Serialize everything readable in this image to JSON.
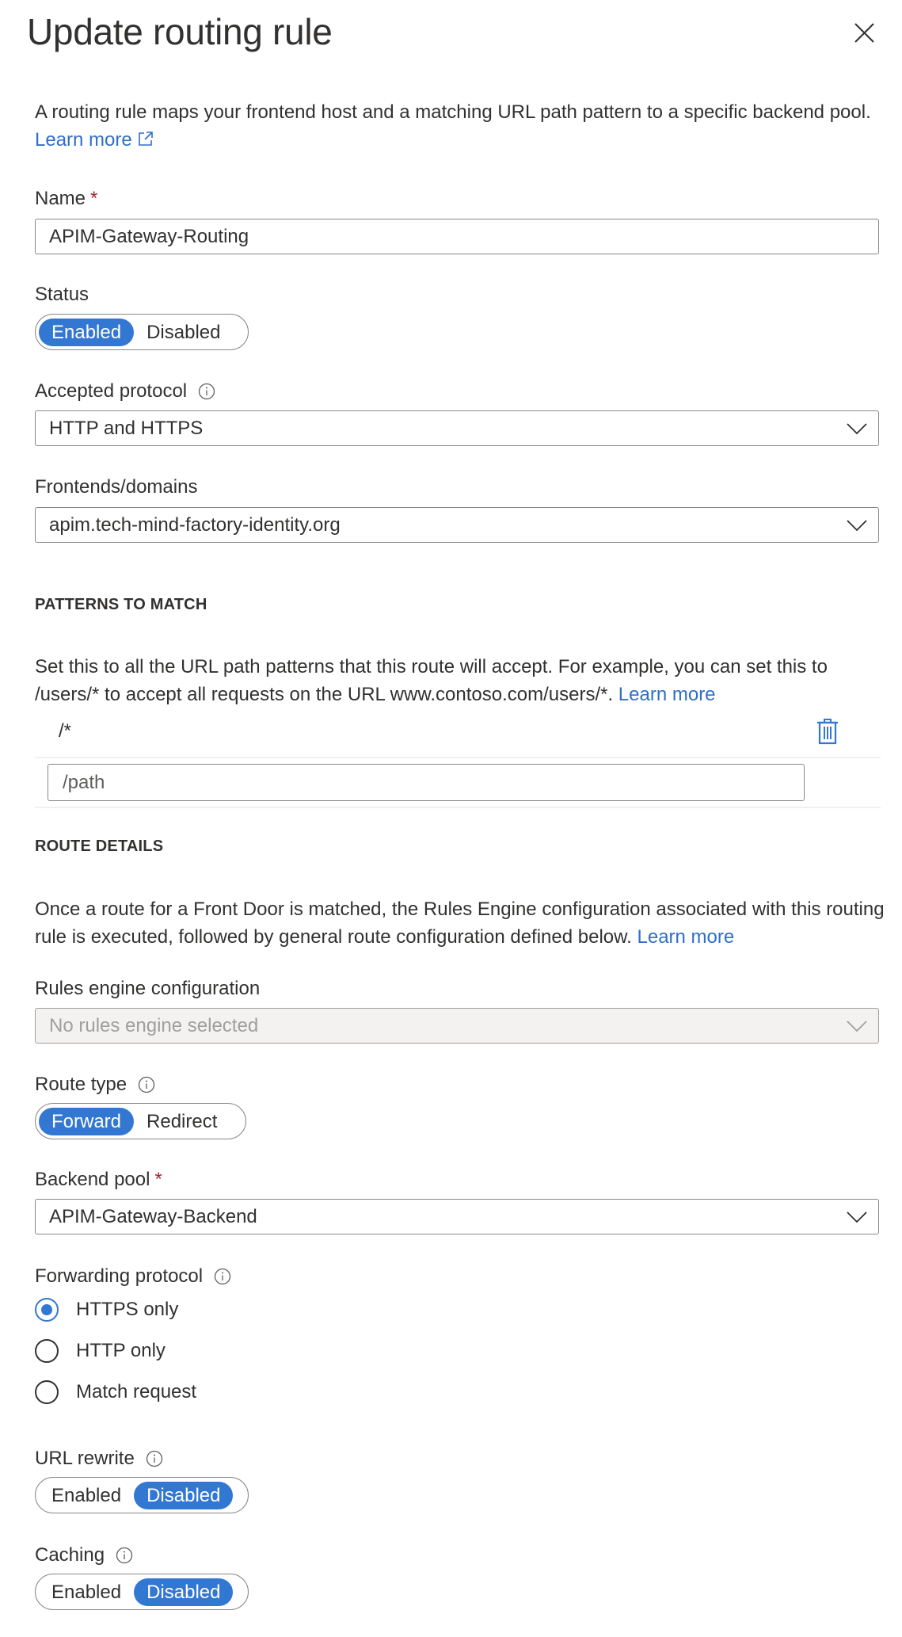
{
  "header": {
    "title": "Update routing rule",
    "close_icon": "close-icon"
  },
  "intro": {
    "text": "A routing rule maps your frontend host and a matching URL path pattern to a specific backend pool.",
    "link": "Learn more",
    "link_icon": "external-link-icon"
  },
  "name": {
    "label": "Name",
    "required_mark": "*",
    "value": "APIM-Gateway-Routing"
  },
  "status": {
    "label": "Status",
    "options": [
      "Enabled",
      "Disabled"
    ],
    "selected": "Enabled"
  },
  "accepted_protocol": {
    "label": "Accepted protocol",
    "value": "HTTP and HTTPS"
  },
  "frontends": {
    "label": "Frontends/domains",
    "value": "apim.tech-mind-factory-identity.org"
  },
  "patterns": {
    "heading": "PATTERNS TO MATCH",
    "description": "Set this to all the URL path patterns that this route will accept. For example, you can set this to /users/* to accept all requests on the URL www.contoso.com/users/*.",
    "link": "Learn more",
    "items": [
      "/*"
    ],
    "new_placeholder": "/path"
  },
  "route_details": {
    "heading": "ROUTE DETAILS",
    "description": "Once a route for a Front Door is matched, the Rules Engine configuration associated with this routing rule is executed, followed by general route configuration defined below.",
    "link": "Learn more"
  },
  "rules_engine": {
    "label": "Rules engine configuration",
    "value": "No rules engine selected"
  },
  "route_type": {
    "label": "Route type",
    "options": [
      "Forward",
      "Redirect"
    ],
    "selected": "Forward"
  },
  "backend_pool": {
    "label": "Backend pool",
    "required_mark": "*",
    "value": "APIM-Gateway-Backend"
  },
  "forwarding_protocol": {
    "label": "Forwarding protocol",
    "options": [
      "HTTPS only",
      "HTTP only",
      "Match request"
    ],
    "selected": "HTTPS only"
  },
  "url_rewrite": {
    "label": "URL rewrite",
    "options": [
      "Enabled",
      "Disabled"
    ],
    "selected": "Disabled"
  },
  "caching": {
    "label": "Caching",
    "options": [
      "Enabled",
      "Disabled"
    ],
    "selected": "Disabled"
  },
  "colors": {
    "accent": "#3277d2",
    "link": "#2f6fc6",
    "required": "#a4262c",
    "text": "#323130",
    "disabled_bg": "#f3f2f1"
  }
}
